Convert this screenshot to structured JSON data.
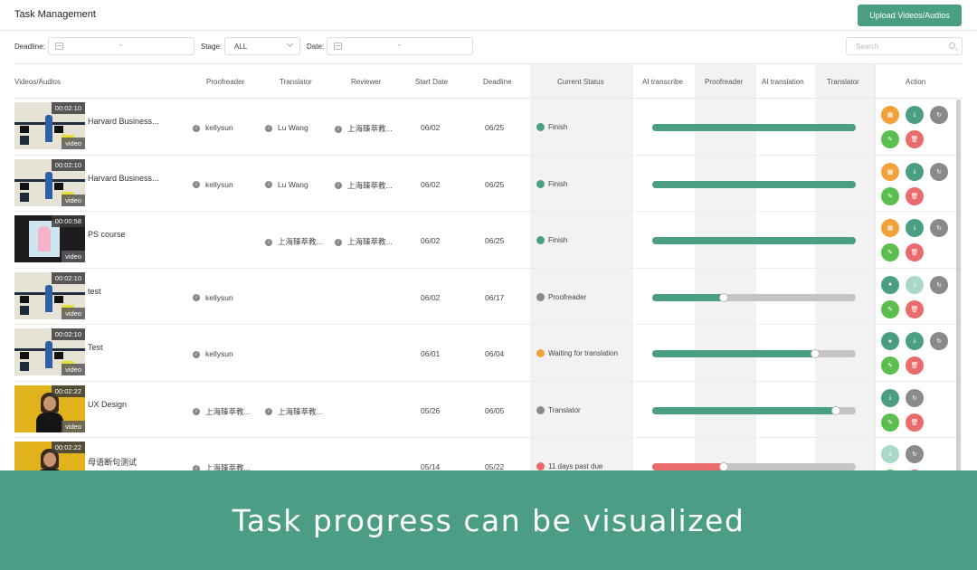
{
  "header": {
    "title": "Task Management",
    "upload_label": "Upload Videos/Audios"
  },
  "filters": {
    "deadline_label": "Deadline:",
    "deadline_sep": "-",
    "stage_label": "Stage:",
    "stage_value": "ALL",
    "date_label": "Date:",
    "date_sep": "-",
    "search_placeholder": "Search"
  },
  "columns": {
    "videos": "Videos/Audios",
    "proofreader": "Proofreader",
    "translator": "Translator",
    "reviewer": "Reviewer",
    "start_date": "Start Date",
    "deadline": "Deadline",
    "current_status": "Current Status",
    "ai_transcribe": "AI transcribe",
    "proofreader2": "Proofreader",
    "ai_translation": "AI translation",
    "translator2": "Translator",
    "action": "Action"
  },
  "colors": {
    "green": "#4a9e84",
    "red": "#ea6b6b",
    "gray": "#8a8a8a",
    "orange": "#f2a23a",
    "track": "#c4c4c4"
  },
  "rows": [
    {
      "thumb": "slide",
      "duration": "00:02:10",
      "tag": "video",
      "name": "Harvard Business...",
      "proofreader": "kellysun",
      "translator": "Lu Wang",
      "reviewer": "上海臻萃教...",
      "start": "06/02",
      "deadline": "06/25",
      "status": "Finish",
      "status_color": "#4a9e84",
      "progress": 1.0,
      "bar_color": "#4a9e84",
      "actions": [
        "#f2a23a",
        "#4a9e84",
        "#8a8a8a",
        "#5bbf4f",
        "#ea6b6b"
      ],
      "action_icons": [
        "calendar-icon",
        "download-icon",
        "refresh-icon",
        "edit-icon",
        "delete-icon"
      ]
    },
    {
      "thumb": "slide",
      "duration": "00:02:10",
      "tag": "video",
      "name": "Harvard Business...",
      "proofreader": "kellysun",
      "translator": "Lu Wang",
      "reviewer": "上海臻萃教...",
      "start": "06/02",
      "deadline": "06/25",
      "status": "Finish",
      "status_color": "#4a9e84",
      "progress": 1.0,
      "bar_color": "#4a9e84",
      "actions": [
        "#f2a23a",
        "#4a9e84",
        "#8a8a8a",
        "#5bbf4f",
        "#ea6b6b"
      ],
      "action_icons": [
        "calendar-icon",
        "download-icon",
        "refresh-icon",
        "edit-icon",
        "delete-icon"
      ]
    },
    {
      "thumb": "dark",
      "duration": "00:00:58",
      "tag": "video",
      "name": "PS course",
      "proofreader": "",
      "translator": "上海臻萃教...",
      "reviewer": "上海臻萃教...",
      "start": "06/02",
      "deadline": "06/25",
      "status": "Finish",
      "status_color": "#4a9e84",
      "progress": 1.0,
      "bar_color": "#4a9e84",
      "actions": [
        "#f2a23a",
        "#4a9e84",
        "#8a8a8a",
        "#5bbf4f",
        "#ea6b6b"
      ],
      "action_icons": [
        "calendar-icon",
        "download-icon",
        "refresh-icon",
        "edit-icon",
        "delete-icon"
      ]
    },
    {
      "thumb": "slide",
      "duration": "00:02:10",
      "tag": "video",
      "name": "test",
      "proofreader": "kellysun",
      "translator": "",
      "reviewer": "",
      "start": "06/02",
      "deadline": "06/17",
      "status": "Proofreader",
      "status_color": "#8a8a8a",
      "progress": 0.35,
      "bar_color": "#4a9e84",
      "actions": [
        "#4a9e84",
        "#a9d8cb",
        "#8a8a8a",
        "#5bbf4f",
        "#ea6b6b"
      ],
      "action_icons": [
        "user-icon",
        "download-icon",
        "refresh-icon",
        "edit-icon",
        "delete-icon"
      ]
    },
    {
      "thumb": "slide",
      "duration": "00:02:10",
      "tag": "video",
      "name": "Test",
      "proofreader": "kellysun",
      "translator": "",
      "reviewer": "",
      "start": "06/01",
      "deadline": "06/04",
      "status": "Waiting for translation",
      "status_color": "#f2a23a",
      "progress": 0.8,
      "bar_color": "#4a9e84",
      "actions": [
        "#4a9e84",
        "#4a9e84",
        "#8a8a8a",
        "#5bbf4f",
        "#ea6b6b"
      ],
      "action_icons": [
        "user-icon",
        "download-icon",
        "refresh-icon",
        "edit-icon",
        "delete-icon"
      ]
    },
    {
      "thumb": "yellow",
      "duration": "00:02:22",
      "tag": "video",
      "name": "UX Design",
      "proofreader": "上海臻萃教...",
      "translator": "上海臻萃教...",
      "reviewer": "",
      "start": "05/26",
      "deadline": "06/05",
      "status": "Translator",
      "status_color": "#8a8a8a",
      "progress": 0.9,
      "bar_color": "#4a9e84",
      "actions": [
        "#4a9e84",
        "#8a8a8a",
        "#5bbf4f",
        "#ea6b6b"
      ],
      "action_icons": [
        "download-icon",
        "refresh-icon",
        "edit-icon",
        "delete-icon"
      ]
    },
    {
      "thumb": "yellow",
      "duration": "00:02:22",
      "tag": "video",
      "name": "母语断句测试",
      "proofreader": "上海臻萃教...",
      "translator": "",
      "reviewer": "",
      "start": "05/14",
      "deadline": "05/22",
      "status": "11 days past due",
      "status_color": "#ea6b6b",
      "progress": 0.35,
      "bar_color": "#ea6b6b",
      "actions": [
        "#a9d8cb",
        "#8a8a8a",
        "#5bbf4f",
        "#ea6b6b"
      ],
      "action_icons": [
        "download-icon",
        "refresh-icon",
        "edit-icon",
        "delete-icon"
      ]
    }
  ],
  "banner": {
    "text": "Task progress can be visualized"
  }
}
